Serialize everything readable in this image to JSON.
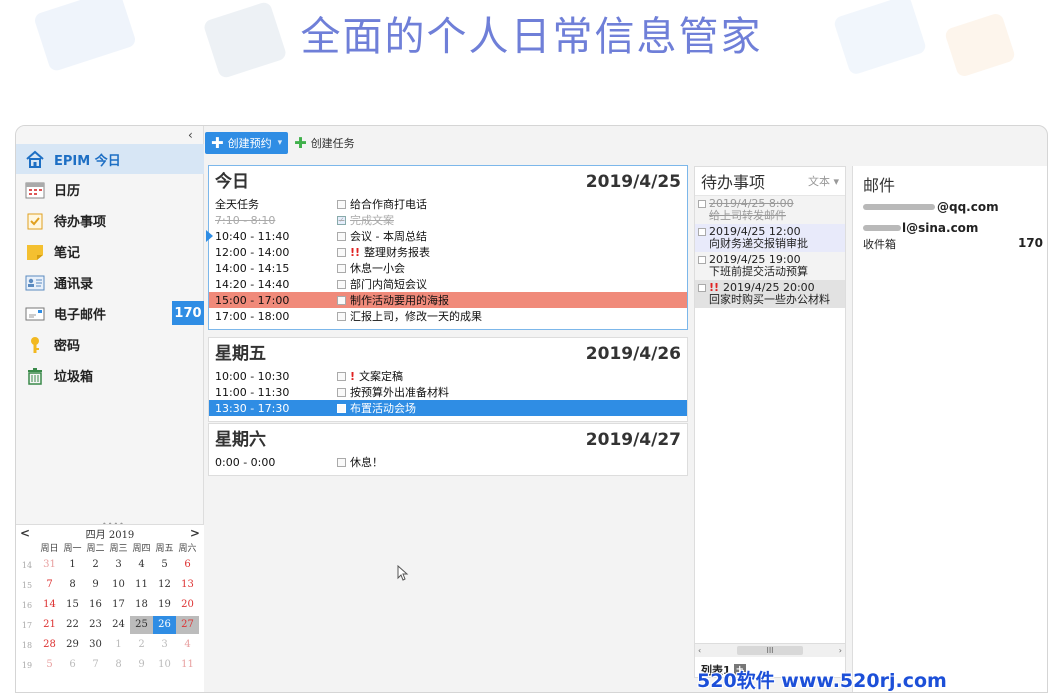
{
  "banner": "全面的个人日常信息管家",
  "sidebar": {
    "collapse": "‹",
    "items": [
      {
        "label": "EPIM 今日",
        "icon": "home-icon",
        "active": true
      },
      {
        "label": "日历",
        "icon": "calendar-icon"
      },
      {
        "label": "待办事项",
        "icon": "todo-icon"
      },
      {
        "label": "笔记",
        "icon": "note-icon"
      },
      {
        "label": "通讯录",
        "icon": "contacts-icon"
      },
      {
        "label": "电子邮件",
        "icon": "email-icon",
        "badge": "170"
      },
      {
        "label": "密码",
        "icon": "key-icon"
      },
      {
        "label": "垃圾箱",
        "icon": "trash-icon"
      }
    ]
  },
  "minical": {
    "prev": "<",
    "next": ">",
    "title": "四月  2019",
    "weekdays": [
      "周日",
      "周一",
      "周二",
      "周三",
      "周四",
      "周五",
      "周六"
    ],
    "weeks": [
      {
        "wk": "14",
        "days": [
          "31",
          "1",
          "2",
          "3",
          "4",
          "5",
          "6"
        ]
      },
      {
        "wk": "15",
        "days": [
          "7",
          "8",
          "9",
          "10",
          "11",
          "12",
          "13"
        ]
      },
      {
        "wk": "16",
        "days": [
          "14",
          "15",
          "16",
          "17",
          "18",
          "19",
          "20"
        ]
      },
      {
        "wk": "17",
        "days": [
          "21",
          "22",
          "23",
          "24",
          "25",
          "26",
          "27"
        ]
      },
      {
        "wk": "18",
        "days": [
          "28",
          "29",
          "30",
          "1",
          "2",
          "3",
          "4"
        ]
      },
      {
        "wk": "19",
        "days": [
          "5",
          "6",
          "7",
          "8",
          "9",
          "10",
          "11"
        ]
      }
    ]
  },
  "toolbar": {
    "new_appointment": "创建预约",
    "new_task": "创建任务"
  },
  "days": [
    {
      "title": "今日",
      "date": "2019/4/25",
      "rows": [
        {
          "time": "全天任务",
          "text": "给合作商打电话"
        },
        {
          "time": "7:10 - 8:10",
          "text": "完成文案",
          "done": true
        },
        {
          "time": "10:40 - 11:40",
          "text": "会议 - 本周总结",
          "marker": true
        },
        {
          "time": "12:00 - 14:00",
          "text": "整理财务报表",
          "priority": "!!"
        },
        {
          "time": "14:00 - 14:15",
          "text": "休息一小会"
        },
        {
          "time": "14:20 - 14:40",
          "text": "部门内简短会议"
        },
        {
          "time": "15:00 - 17:00",
          "text": "制作活动要用的海报",
          "highlight": "salmon"
        },
        {
          "time": "17:00 - 18:00",
          "text": "汇报上司，修改一天的成果"
        }
      ]
    },
    {
      "title": "星期五",
      "date": "2019/4/26",
      "rows": [
        {
          "time": "10:00 - 10:30",
          "text": "文案定稿",
          "priority": "!"
        },
        {
          "time": "11:00 - 11:30",
          "text": "按预算外出准备材料"
        },
        {
          "time": "13:30 - 17:30",
          "text": "布置活动会场",
          "highlight": "blue"
        }
      ]
    },
    {
      "title": "星期六",
      "date": "2019/4/27",
      "rows": [
        {
          "time": "0:00 - 0:00",
          "text": "休息！"
        }
      ]
    }
  ],
  "todo": {
    "title": "待办事项",
    "view": "文本 ▾",
    "items": [
      {
        "line1": "2019/4/25 8:00",
        "line2": "给上司转发邮件",
        "state": "done"
      },
      {
        "line1": "2019/4/25 12:00",
        "line2": "向财务递交报销审批",
        "state": "hl"
      },
      {
        "line1": "2019/4/25 19:00",
        "line2": "下班前提交活动预算",
        "state": ""
      },
      {
        "line1": "2019/4/25 20:00",
        "line2": "回家时购买一些办公材料",
        "state": "gray",
        "priority": "!!"
      }
    ],
    "tab": "列表1",
    "scroll_left": "‹",
    "scroll_right": "›",
    "scroll_thumb": "III"
  },
  "mail": {
    "title": "邮件",
    "accounts": [
      "@qq.com",
      "l@sina.com"
    ],
    "inbox_label": "收件箱",
    "inbox_count": "170"
  },
  "watermark": "520软件 www.520rj.com"
}
